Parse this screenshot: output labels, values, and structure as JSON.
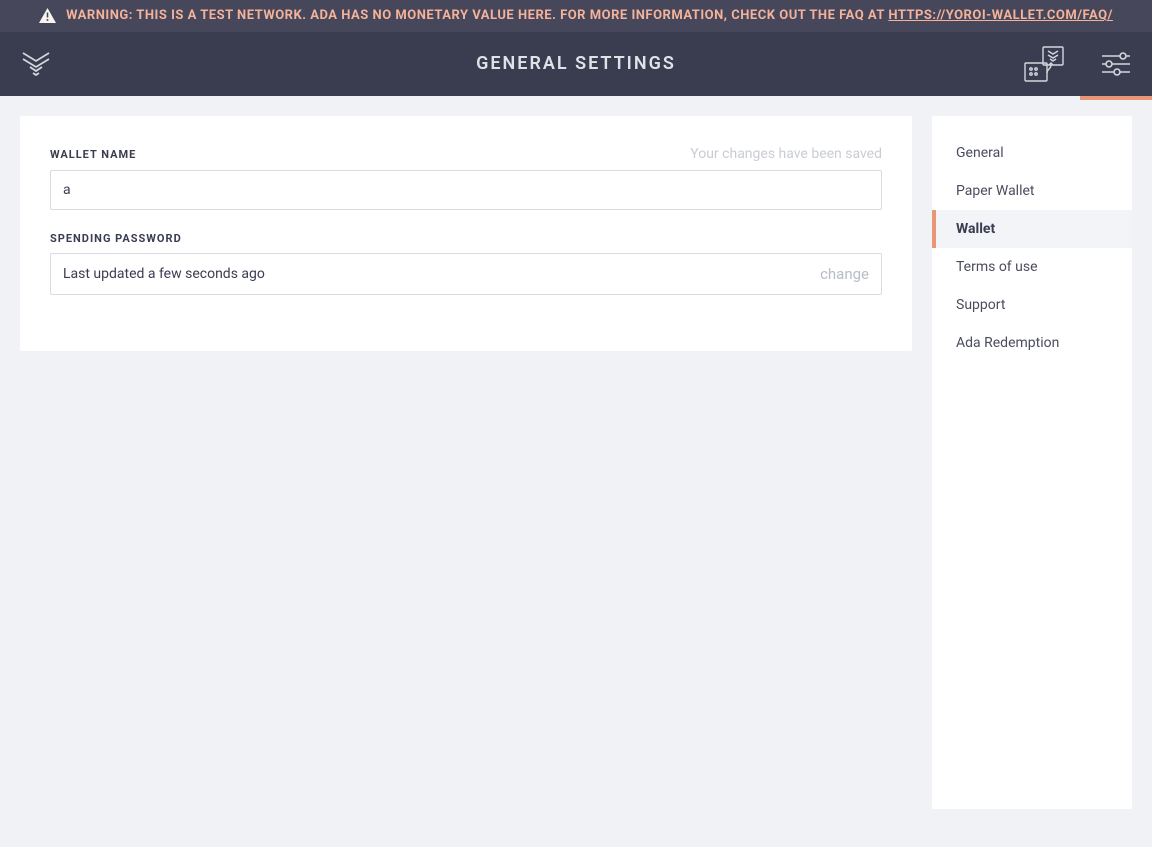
{
  "warning": {
    "prefix": "WARNING: THIS IS A TEST NETWORK. ADA HAS NO MONETARY VALUE HERE. FOR MORE INFORMATION, CHECK OUT THE FAQ AT ",
    "link_text": "HTTPS://YOROI-WALLET.COM/FAQ/"
  },
  "header": {
    "title": "GENERAL SETTINGS"
  },
  "wallet_name": {
    "label": "WALLET NAME",
    "status": "Your changes have been saved",
    "value": "a"
  },
  "spending_password": {
    "label": "SPENDING PASSWORD",
    "status": "Last updated a few seconds ago",
    "change_label": "change"
  },
  "sidebar": {
    "items": [
      {
        "label": "General"
      },
      {
        "label": "Paper Wallet"
      },
      {
        "label": "Wallet"
      },
      {
        "label": "Terms of use"
      },
      {
        "label": "Support"
      },
      {
        "label": "Ada Redemption"
      }
    ],
    "active_index": 2
  },
  "colors": {
    "accent": "#e99578",
    "header_bg": "#3a3c50",
    "warning_bg": "#46475a"
  }
}
